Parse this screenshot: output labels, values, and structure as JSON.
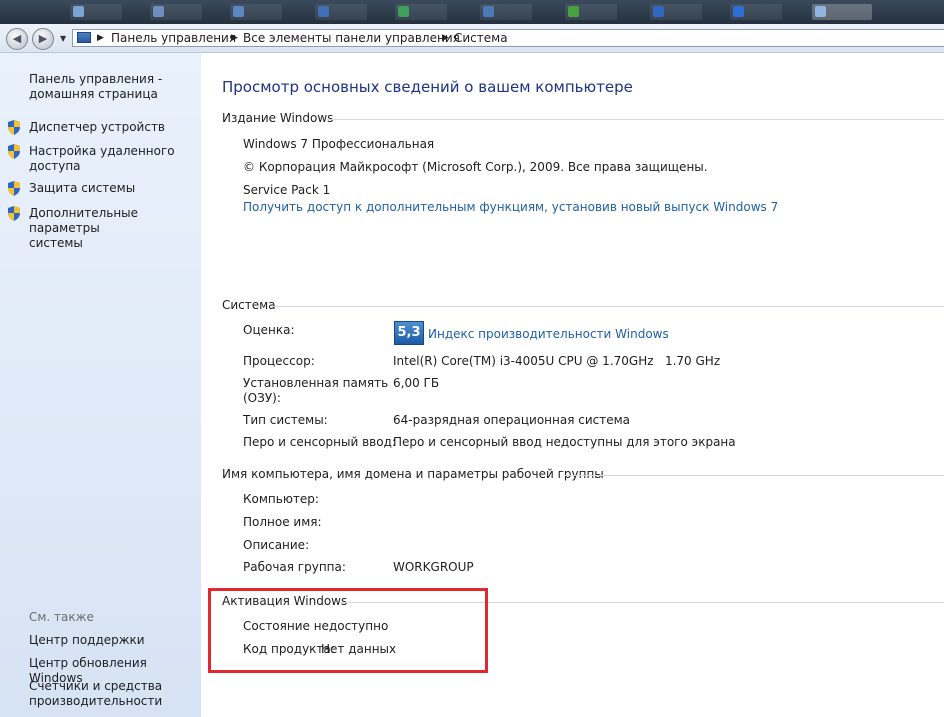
{
  "breadcrumb": [
    "Панель управления",
    "Все элементы панели управления",
    "Система"
  ],
  "sidebar": {
    "home_link": [
      "Панель управления -",
      "домашняя страница"
    ],
    "items": [
      {
        "label": [
          "Диспетчер устройств"
        ],
        "icon": "shield-icon"
      },
      {
        "label": [
          "Настройка удаленного",
          "доступа"
        ],
        "icon": "shield-icon"
      },
      {
        "label": [
          "Защита системы"
        ],
        "icon": "shield-icon"
      },
      {
        "label": [
          "Дополнительные параметры",
          "системы"
        ],
        "icon": "shield-icon"
      }
    ],
    "see_also": "См. также",
    "see_also_links": [
      [
        "Центр поддержки"
      ],
      [
        "Центр обновления Windows"
      ],
      [
        "Счетчики и средства",
        "производительности"
      ]
    ]
  },
  "main": {
    "title": "Просмотр основных сведений о вашем компьютере",
    "edition": {
      "heading": "Издание Windows",
      "name": "Windows 7 Профессиональная",
      "copyright": "© Корпорация Майкрософт (Microsoft Corp.), 2009. Все права защищены.",
      "service_pack": "Service Pack 1",
      "upgrade_link": "Получить доступ к дополнительным функциям, установив новый выпуск Windows 7"
    },
    "system": {
      "heading": "Система",
      "rating_label": "Оценка:",
      "rating_value": "5,3",
      "rating_link": "Индекс производительности Windows",
      "processor_label": "Процессор:",
      "processor_value": "Intel(R) Core(TM) i3-4005U CPU @ 1.70GHz   1.70 GHz",
      "memory_label": [
        "Установленная память",
        "(ОЗУ):"
      ],
      "memory_value": "6,00 ГБ",
      "type_label": "Тип системы:",
      "type_value": "64-разрядная операционная система",
      "pen_label": "Перо и сенсорный ввод:",
      "pen_value": "Перо и сенсорный ввод недоступны для этого экрана"
    },
    "computer": {
      "heading": "Имя компьютера, имя домена и параметры рабочей группы",
      "computer_label": "Компьютер:",
      "fullname_label": "Полное имя:",
      "description_label": "Описание:",
      "workgroup_label": "Рабочая группа:",
      "workgroup_value": "WORKGROUP"
    },
    "activation": {
      "heading": "Активация Windows",
      "status": "Состояние недоступно",
      "product_key_label": "Код продукта:",
      "product_key_value": "Нет данных"
    }
  },
  "colors": {
    "highlight_border": "#e0282e",
    "link": "#1f5fa8",
    "title": "#1e3287",
    "sidebar_bg": "#dfe9f7"
  }
}
